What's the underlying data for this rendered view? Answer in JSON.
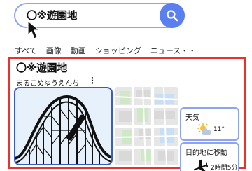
{
  "search": {
    "query": "〇※遊園地",
    "icon": "search-icon"
  },
  "tabs": [
    {
      "label": "すべて"
    },
    {
      "label": "画像"
    },
    {
      "label": "動画"
    },
    {
      "label": "ショッピング"
    },
    {
      "label": "ニュース・・"
    }
  ],
  "result": {
    "title": "〇※遊園地",
    "reading": "まるこめゆうえんち",
    "weather": {
      "label": "天気",
      "temperature": "11°",
      "icon": "partly-sunny-icon"
    },
    "route": {
      "label": "目的地に移動",
      "time": "2時間5分",
      "icon": "airplane-icon"
    }
  },
  "colors": {
    "accent": "#5a7ff0",
    "panel_border": "#e8322e",
    "card_border": "#8ea4f0"
  }
}
